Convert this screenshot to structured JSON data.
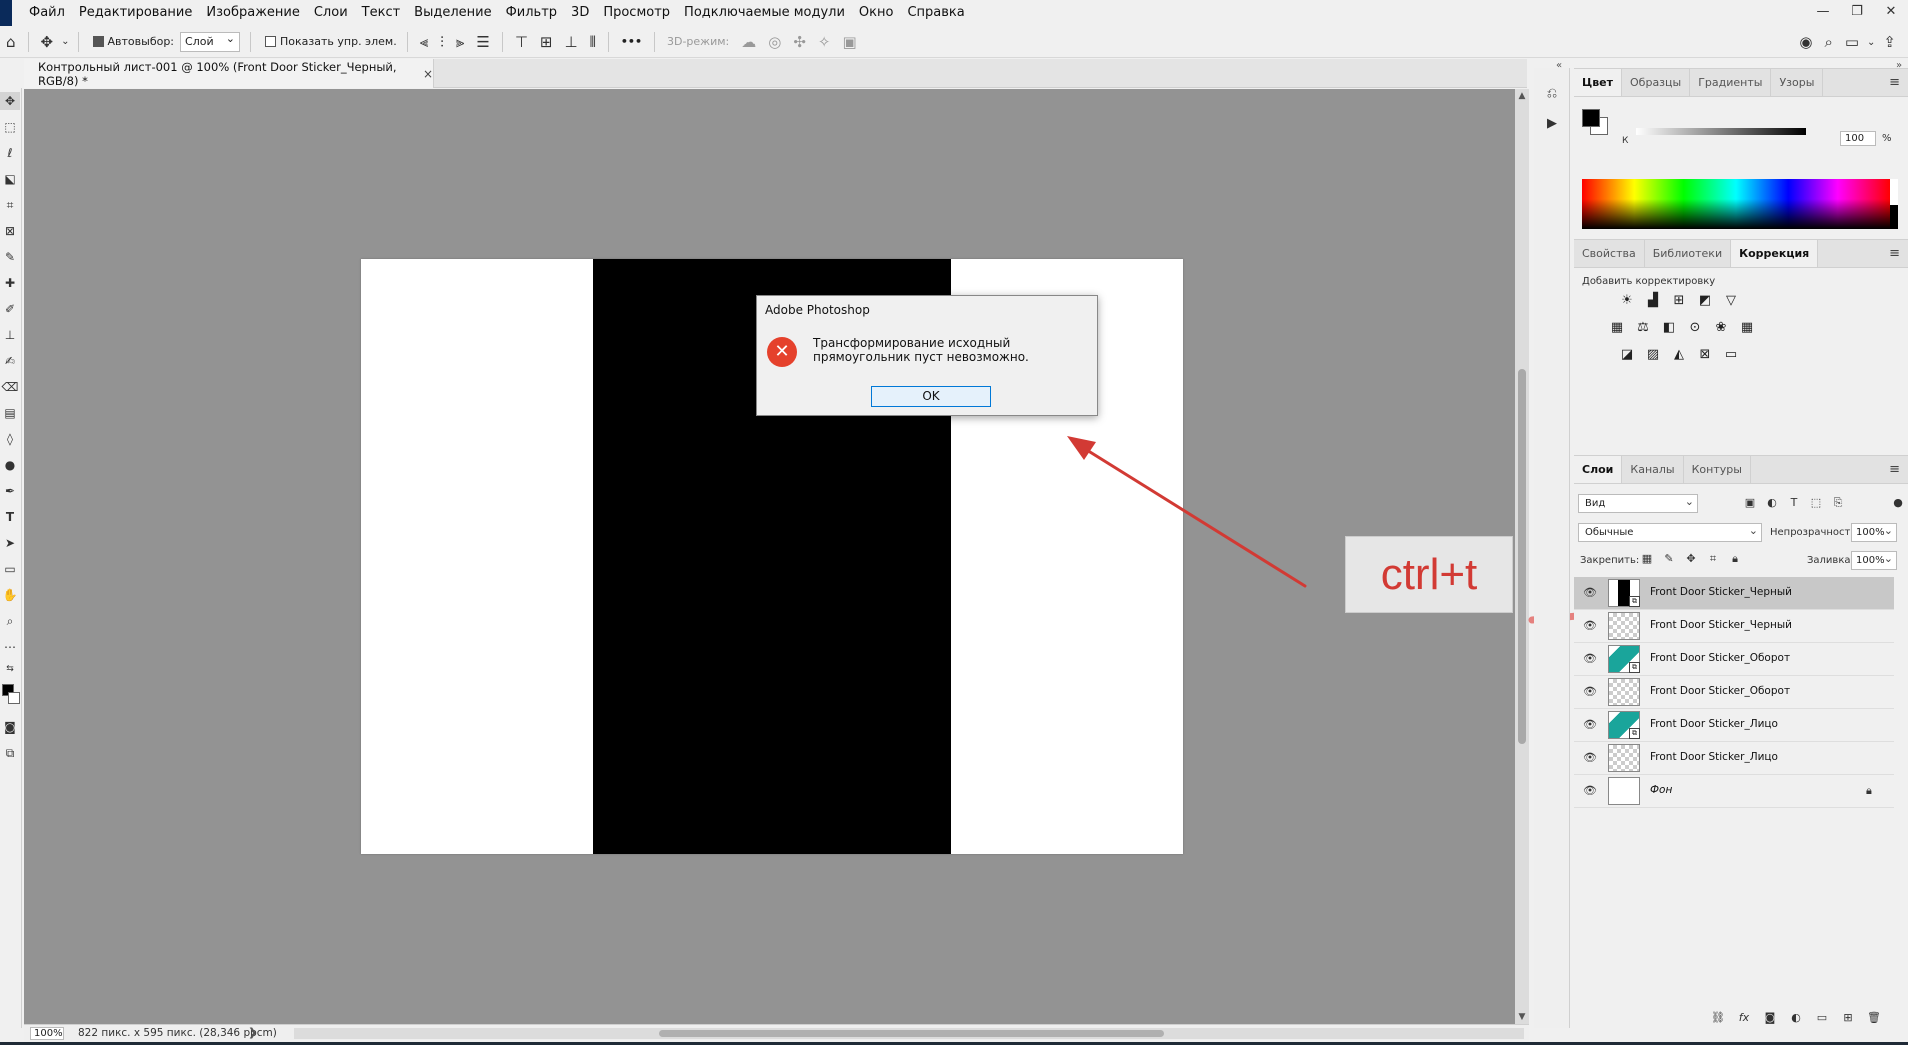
{
  "menubar": {
    "items": [
      "Файл",
      "Редактирование",
      "Изображение",
      "Слои",
      "Текст",
      "Выделение",
      "Фильтр",
      "3D",
      "Просмотр",
      "Подключаемые модули",
      "Окно",
      "Справка"
    ],
    "window_controls": {
      "minimize": "—",
      "restore": "❐",
      "close": "✕"
    }
  },
  "options": {
    "autoselect_label": "Автовыбор:",
    "autoselect_value": "Слой",
    "show_transform_label": "Показать упр. элем.",
    "mode_3d_label": "3D-режим:",
    "more_label": "•••"
  },
  "document": {
    "tab_title": "Контрольный лист-001 @ 100% (Front Door Sticker_Черный, RGB/8) *",
    "tab_close": "×"
  },
  "dialog": {
    "title": "Adobe Photoshop",
    "message": "Трансформирование исходный прямоугольник пуст невозможно.",
    "ok_label": "OK"
  },
  "annotation": {
    "shortcut": "ctrl+t"
  },
  "statusbar": {
    "zoom": "100%",
    "doc_size": "822 пикс. x 595 пикс. (28,346 ppcm)",
    "arrow": "❯"
  },
  "color_panel": {
    "tabs": [
      "Цвет",
      "Образцы",
      "Градиенты",
      "Узоры"
    ],
    "active_tab": 0,
    "channel_label": "К",
    "channel_value": "100",
    "channel_unit": "%"
  },
  "adjust_panel": {
    "tabs": [
      "Свойства",
      "Библиотеки",
      "Коррекция"
    ],
    "active_tab": 2,
    "add_label": "Добавить корректировку"
  },
  "layers_panel": {
    "tabs": [
      "Слои",
      "Каналы",
      "Контуры"
    ],
    "active_tab": 0,
    "kind_filter": "Вид",
    "blend_mode": "Обычные",
    "opacity_label": "Непрозрачность:",
    "opacity_value": "100%",
    "lock_label": "Закрепить:",
    "fill_label": "Заливка:",
    "fill_value": "100%",
    "layers": [
      {
        "name": "Front Door Sticker_Черный",
        "thumb": "smart-black",
        "selected": true
      },
      {
        "name": "Front Door Sticker_Черный",
        "thumb": "transparent",
        "selected": false
      },
      {
        "name": "Front Door Sticker_Оборот",
        "thumb": "smart-teal",
        "selected": false
      },
      {
        "name": "Front Door Sticker_Оборот",
        "thumb": "transparent",
        "selected": false
      },
      {
        "name": "Front Door Sticker_Лицо",
        "thumb": "smart-teal",
        "selected": false
      },
      {
        "name": "Front Door Sticker_Лицо",
        "thumb": "transparent",
        "selected": false
      },
      {
        "name": "Фон",
        "thumb": "solid-white",
        "selected": false,
        "locked": true
      }
    ]
  },
  "colors": {
    "annotation_red": "#d23a34",
    "canvas_gray": "#939393",
    "error_red": "#e5412c",
    "ok_border": "#0078d7"
  }
}
